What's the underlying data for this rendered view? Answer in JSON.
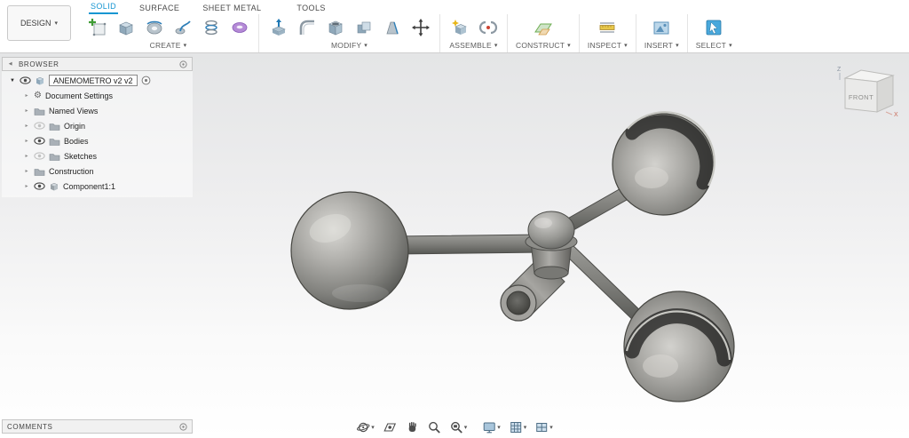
{
  "app": {
    "design_button": {
      "label": "DESIGN"
    },
    "tabs": [
      {
        "label": "SOLID",
        "active": true
      },
      {
        "label": "SURFACE",
        "active": false
      },
      {
        "label": "SHEET METAL",
        "active": false
      },
      {
        "label": "TOOLS",
        "active": false
      }
    ],
    "ribbon_groups": [
      {
        "label": "CREATE"
      },
      {
        "label": "MODIFY"
      },
      {
        "label": "ASSEMBLE"
      },
      {
        "label": "CONSTRUCT"
      },
      {
        "label": "INSPECT"
      },
      {
        "label": "INSERT"
      },
      {
        "label": "SELECT"
      }
    ]
  },
  "browser": {
    "title": "BROWSER",
    "root": {
      "label": "ANEMOMETRO v2 v2",
      "eye": "on"
    },
    "items": [
      {
        "label": "Document Settings",
        "icon": "gear",
        "eye": "none"
      },
      {
        "label": "Named Views",
        "icon": "folder",
        "eye": "none"
      },
      {
        "label": "Origin",
        "icon": "folder",
        "eye": "off"
      },
      {
        "label": "Bodies",
        "icon": "folder",
        "eye": "on"
      },
      {
        "label": "Sketches",
        "icon": "folder",
        "eye": "off"
      },
      {
        "label": "Construction",
        "icon": "folder",
        "eye": "none"
      },
      {
        "label": "Component1:1",
        "icon": "component",
        "eye": "on"
      }
    ]
  },
  "comments": {
    "title": "COMMENTS"
  },
  "viewcube": {
    "front": "FRONT",
    "axis_z": "Z",
    "axis_x": "X"
  },
  "bottom_toolbar": {
    "buttons": [
      "orbit",
      "look-at",
      "pan",
      "zoom",
      "zoom-window",
      "display-settings",
      "grid-snaps",
      "viewports"
    ]
  },
  "icons": {
    "caret_down": "▾",
    "tree_expanded": "▼",
    "tree_collapsed": "▸",
    "panel_collapse": "◀",
    "gear": "⚙"
  },
  "colors": {
    "accent_blue": "#1796d2",
    "model_gray": "#8a8a86"
  }
}
